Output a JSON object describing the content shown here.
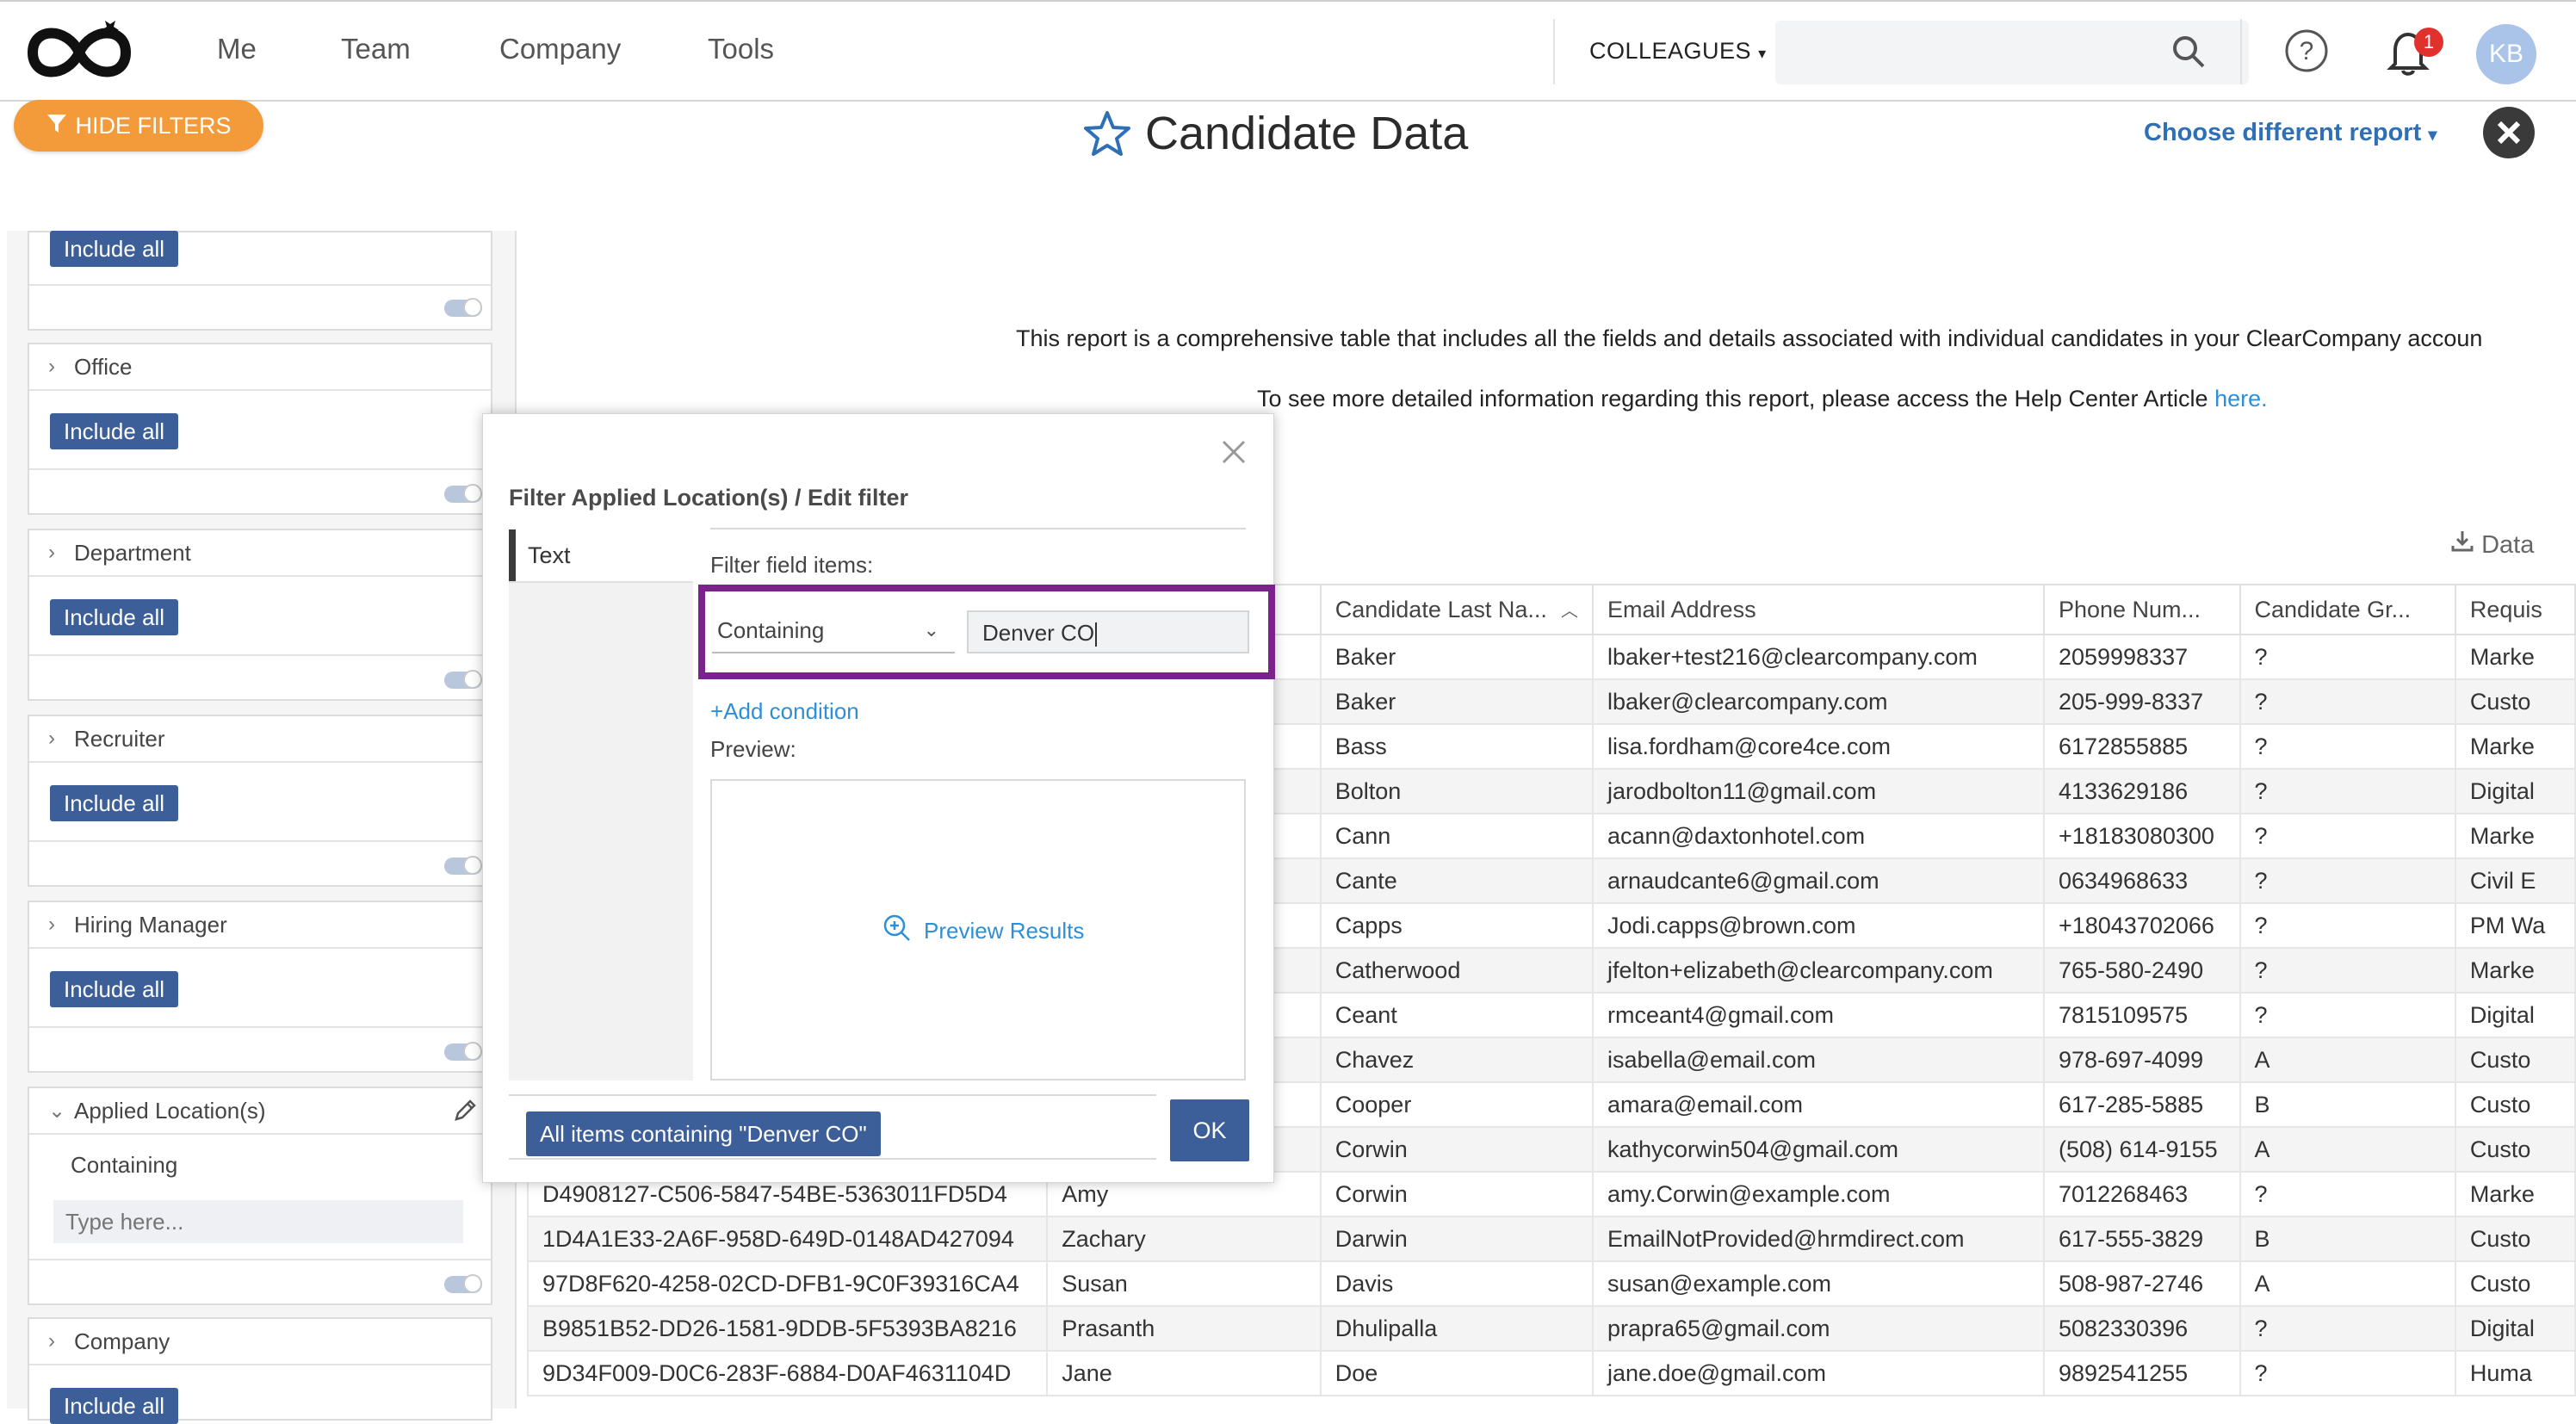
{
  "nav": {
    "links": [
      "Me",
      "Team",
      "Company",
      "Tools"
    ],
    "colleagues_label": "COLLEAGUES",
    "search_placeholder": "",
    "notification_count": "1",
    "avatar_initials": "KB"
  },
  "header": {
    "hide_filters_label": "HIDE FILTERS",
    "title": "Candidate Data",
    "choose_report_label": "Choose different report"
  },
  "filters": {
    "top_include_label": "Include all",
    "cards": [
      {
        "title": "Office",
        "include_label": "Include all"
      },
      {
        "title": "Department",
        "include_label": "Include all"
      },
      {
        "title": "Recruiter",
        "include_label": "Include all"
      },
      {
        "title": "Hiring Manager",
        "include_label": "Include all"
      }
    ],
    "applied_location": {
      "title": "Applied Location(s)",
      "condition": "Containing",
      "input_placeholder": "Type here..."
    },
    "company": {
      "title": "Company",
      "include_label": "Include all"
    }
  },
  "report": {
    "description": "This report is a comprehensive table that includes all the fields and details associated with individual candidates in your ClearCompany accoun",
    "help_text": "To see more detailed information regarding this report, please access the Help Center Article ",
    "help_link": "here.",
    "export_label": "Data"
  },
  "table": {
    "headers": [
      "",
      "",
      "Candidate Last Na...",
      "Email Address",
      "Phone Num...",
      "Candidate Gr...",
      "Requis"
    ],
    "rows": [
      [
        "",
        "",
        "Baker",
        "lbaker+test216@clearcompany.com",
        "2059998337",
        "?",
        "Marke"
      ],
      [
        "",
        "",
        "Baker",
        "lbaker@clearcompany.com",
        "205-999-8337",
        "?",
        "Custo"
      ],
      [
        "",
        "",
        "Bass",
        "lisa.fordham@core4ce.com",
        "6172855885",
        "?",
        "Marke"
      ],
      [
        "",
        "",
        "Bolton",
        "jarodbolton11@gmail.com",
        "4133629186",
        "?",
        "Digital"
      ],
      [
        "",
        "",
        "Cann",
        "acann@daxtonhotel.com",
        "+18183080300",
        "?",
        "Marke"
      ],
      [
        "",
        "",
        "Cante",
        "arnaudcante6@gmail.com",
        "0634968633",
        "?",
        "Civil E"
      ],
      [
        "",
        "",
        "Capps",
        "Jodi.capps@brown.com",
        "+18043702066",
        "?",
        "PM Wa"
      ],
      [
        "",
        "",
        "Catherwood",
        "jfelton+elizabeth@clearcompany.com",
        "765-580-2490",
        "?",
        "Marke"
      ],
      [
        "",
        "",
        "Ceant",
        "rmceant4@gmail.com",
        "7815109575",
        "?",
        "Digital"
      ],
      [
        "",
        "",
        "Chavez",
        "isabella@email.com",
        "978-697-4099",
        "A",
        "Custo"
      ],
      [
        "",
        "",
        "Cooper",
        "amara@email.com",
        "617-285-5885",
        "B",
        "Custo"
      ],
      [
        "",
        "",
        "Corwin",
        "kathycorwin504@gmail.com",
        "(508) 614-9155",
        "A",
        "Custo"
      ],
      [
        "D4908127-C506-5847-54BE-5363011FD5D4",
        "Amy",
        "Corwin",
        "amy.Corwin@example.com",
        "7012268463",
        "?",
        "Marke"
      ],
      [
        "1D4A1E33-2A6F-958D-649D-0148AD427094",
        "Zachary",
        "Darwin",
        "EmailNotProvided@hrmdirect.com",
        "617-555-3829",
        "B",
        "Custo"
      ],
      [
        "97D8F620-4258-02CD-DFB1-9C0F39316CA4",
        "Susan",
        "Davis",
        "susan@example.com",
        "508-987-2746",
        "A",
        "Custo"
      ],
      [
        "B9851B52-DD26-1581-9DDB-5F5393BA8216",
        "Prasanth",
        "Dhulipalla",
        "prapra65@gmail.com",
        "5082330396",
        "?",
        "Digital"
      ],
      [
        "9D34F009-D0C6-283F-6884-D0AF4631104D",
        "Jane",
        "Doe",
        "jane.doe@gmail.com",
        "9892541255",
        "?",
        "Huma"
      ]
    ]
  },
  "modal": {
    "title": "Filter Applied Location(s) / Edit filter",
    "side_tab": "Text",
    "filter_items_label": "Filter field items:",
    "condition": "Containing",
    "value": "Denver CO",
    "add_condition": "Add condition",
    "preview_label": "Preview:",
    "preview_button": "Preview Results",
    "chip": "All items containing \"Denver CO\"",
    "ok": "OK"
  },
  "colors": {
    "accent_orange": "#f39b3a",
    "primary_blue": "#3d5f99",
    "link_blue": "#2e8fd6",
    "highlight_purple": "#7a238a"
  }
}
